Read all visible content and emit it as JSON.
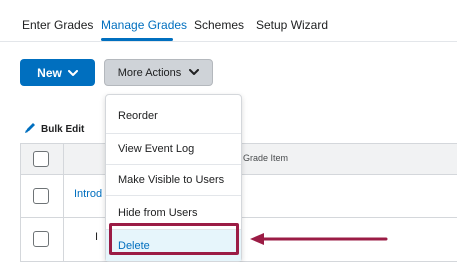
{
  "tabs": [
    {
      "label": "Enter Grades",
      "active": false
    },
    {
      "label": "Manage Grades",
      "active": true
    },
    {
      "label": "Schemes",
      "active": false
    },
    {
      "label": "Setup Wizard",
      "active": false
    }
  ],
  "toolbar": {
    "new_label": "New",
    "more_actions_label": "More Actions"
  },
  "bulk_edit": {
    "label": "Bulk Edit",
    "icon": "pencil-icon"
  },
  "table": {
    "column_header": "Grade Item",
    "rows": [
      {
        "text": "Introd"
      },
      {
        "text": "I"
      }
    ]
  },
  "menu": {
    "items": [
      {
        "label": "Reorder"
      },
      {
        "label": "View Event Log"
      },
      {
        "label": "Make Visible to Users"
      },
      {
        "label": "Hide from Users"
      },
      {
        "label": "Delete"
      }
    ]
  },
  "colors": {
    "accent": "#006fbf",
    "highlight": "#9b1c45",
    "selected_bg": "#e6f5fb"
  }
}
